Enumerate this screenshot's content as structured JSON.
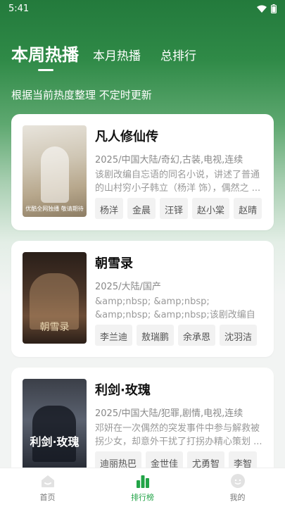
{
  "status_bar": {
    "time": "5:41"
  },
  "tabs": [
    {
      "label": "本周热播",
      "active": true
    },
    {
      "label": "本月热播",
      "active": false
    },
    {
      "label": "总排行",
      "active": false
    }
  ],
  "subtitle": "根据当前热度整理 不定时更新",
  "items": [
    {
      "title": "凡人修仙传",
      "meta": "2025/中国大陆/奇幻,古装,电视,连续",
      "desc": "该剧改编自忘语的同名小说，讲述了普通的山村穷小子韩立（杨洋 饰），偶然之 ...",
      "cast": [
        "杨洋",
        "金晨",
        "汪铎",
        "赵小棠",
        "赵晴"
      ],
      "poster_text": "优酷全网独播 敬请期待"
    },
    {
      "title": "朝雪录",
      "meta": "2025/大陆/国产",
      "desc": "&amp;nbsp; &amp;nbsp; &amp;nbsp; &amp;nbsp;该剧改编自步月浅妆的小说 ...",
      "cast": [
        "李兰迪",
        "敖瑞鹏",
        "余承恩",
        "沈羽洁"
      ],
      "poster_text": "朝雪录"
    },
    {
      "title": "利剑·玫瑰",
      "meta": "2025/中国大陆/犯罪,剧情,电视,连续",
      "desc": "邓妍在一次偶然的突发事件中参与解救被拐少女，却意外干扰了打拐办精心策划 ...",
      "cast": [
        "迪丽热巴",
        "金世佳",
        "尤勇智",
        "李智"
      ],
      "poster_text": "利剑·玫瑰"
    }
  ],
  "bottom_nav": [
    {
      "label": "首页",
      "icon": "home-icon",
      "active": false
    },
    {
      "label": "排行榜",
      "icon": "ranking-icon",
      "active": true
    },
    {
      "label": "我的",
      "icon": "profile-icon",
      "active": false
    }
  ],
  "colors": {
    "accent": "#22a447",
    "hero": "#2f8a47"
  }
}
